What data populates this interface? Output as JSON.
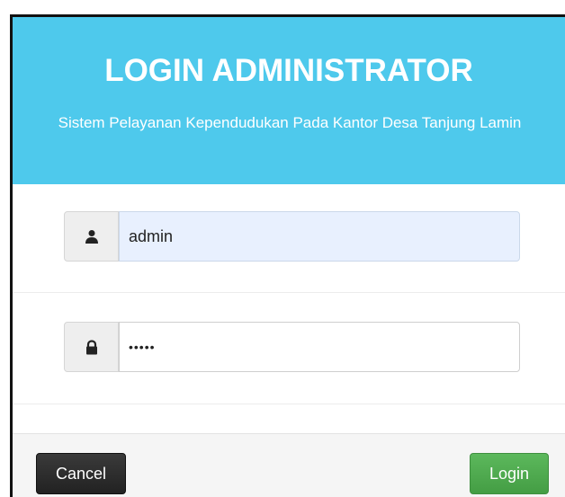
{
  "header": {
    "title": "LOGIN ADMINISTRATOR",
    "subtitle": "Sistem Pelayanan Kependudukan Pada Kantor Desa Tanjung Lamin",
    "background_color": "#4ec9ec"
  },
  "form": {
    "username": {
      "icon": "user-icon",
      "value": "admin"
    },
    "password": {
      "icon": "lock-icon",
      "value": "•••••"
    }
  },
  "footer": {
    "cancel_label": "Cancel",
    "login_label": "Login",
    "cancel_color": "#222222",
    "login_color": "#5cb85c"
  }
}
